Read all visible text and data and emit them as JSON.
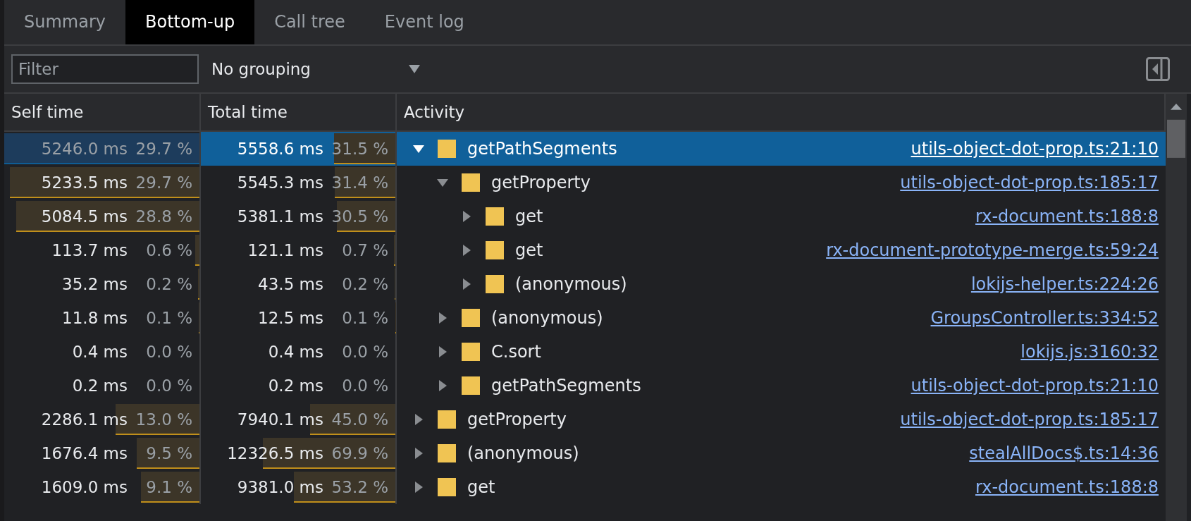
{
  "tabs": [
    {
      "label": "Summary",
      "selected": false
    },
    {
      "label": "Bottom-up",
      "selected": true
    },
    {
      "label": "Call tree",
      "selected": false
    },
    {
      "label": "Event log",
      "selected": false
    }
  ],
  "toolbar": {
    "filter": {
      "placeholder": "Filter"
    },
    "grouping": {
      "value": "No grouping"
    }
  },
  "table": {
    "columns": [
      "Self time",
      "Total time",
      "Activity"
    ],
    "rows": [
      {
        "self_time": "5246.0 ms",
        "self_percent": "29.7 %",
        "self_bar": {
          "level": 1.0
        },
        "total_time": "5558.6 ms",
        "total_percent": "31.5 %",
        "total_bar": {
          "level": 0.315
        },
        "activity": "getPathSegments",
        "source": "utils-object-dot-prop.ts:21:10",
        "expanded": true,
        "selected": true,
        "children": [
          {
            "self_time": "5233.5 ms",
            "self_percent": "29.7 %",
            "self_bar": {
              "level": 0.97
            },
            "total_time": "5545.3 ms",
            "total_percent": "31.4 %",
            "total_bar": {
              "level": 0.31
            },
            "activity": "getProperty",
            "source": "utils-object-dot-prop.ts:185:17",
            "expanded": true,
            "selected": false,
            "children": [
              {
                "self_time": "5084.5 ms",
                "self_percent": "28.8 %",
                "self_bar": {
                  "level": 0.94
                },
                "total_time": "5381.1 ms",
                "total_percent": "30.5 %",
                "total_bar": {
                  "level": 0.3
                },
                "activity": "get",
                "source": "rx-document.ts:188:8",
                "expanded": false,
                "selected": false
              },
              {
                "self_time": "113.7 ms",
                "self_percent": "0.6 %",
                "self_bar": {
                  "level": 0.02
                },
                "total_time": "121.1 ms",
                "total_percent": "0.7 %",
                "total_bar": {
                  "level": 0.007
                },
                "activity": "get",
                "source": "rx-document-prototype-merge.ts:59:24",
                "expanded": false,
                "selected": false
              },
              {
                "self_time": "35.2 ms",
                "self_percent": "0.2 %",
                "self_bar": {
                  "level": 0.007
                },
                "total_time": "43.5 ms",
                "total_percent": "0.2 %",
                "total_bar": {
                  "level": 0.003
                },
                "activity": "(anonymous)",
                "source": "lokijs-helper.ts:224:26",
                "expanded": false,
                "selected": false
              }
            ]
          },
          {
            "self_time": "11.8 ms",
            "self_percent": "0.1 %",
            "self_bar": {
              "level": 0.004
            },
            "total_time": "12.5 ms",
            "total_percent": "0.1 %",
            "total_bar": {
              "level": 0.001
            },
            "activity": "(anonymous)",
            "source": "GroupsController.ts:334:52",
            "expanded": false,
            "selected": false
          },
          {
            "self_time": "0.4 ms",
            "self_percent": "0.0 %",
            "total_time": "0.4 ms",
            "total_percent": "0.0 %",
            "activity": "C.sort",
            "source": "lokijs.js:3160:32",
            "expanded": false,
            "selected": false
          },
          {
            "self_time": "0.2 ms",
            "self_percent": "0.0 %",
            "total_time": "0.2 ms",
            "total_percent": "0.0 %",
            "activity": "getPathSegments",
            "source": "utils-object-dot-prop.ts:21:10",
            "expanded": false,
            "selected": false
          }
        ]
      },
      {
        "self_time": "2286.1 ms",
        "self_percent": "13.0 %",
        "self_bar": {
          "level": 0.43
        },
        "total_time": "7940.1 ms",
        "total_percent": "45.0 %",
        "total_bar": {
          "level": 0.44
        },
        "activity": "getProperty",
        "source": "utils-object-dot-prop.ts:185:17",
        "expanded": false,
        "selected": false
      },
      {
        "self_time": "1676.4 ms",
        "self_percent": "9.5 %",
        "self_bar": {
          "level": 0.32
        },
        "total_time": "12326.5 ms",
        "total_percent": "69.9 %",
        "total_bar": {
          "level": 0.68
        },
        "activity": "(anonymous)",
        "source": "stealAllDocs$.ts:14:36",
        "expanded": false,
        "selected": false
      },
      {
        "self_time": "1609.0 ms",
        "self_percent": "9.1 %",
        "self_bar": {
          "level": 0.3
        },
        "total_time": "9381.0 ms",
        "total_percent": "53.2 %",
        "total_bar": {
          "level": 0.52
        },
        "activity": "get",
        "source": "rx-document.ts:188:8",
        "expanded": false,
        "selected": false
      }
    ]
  }
}
